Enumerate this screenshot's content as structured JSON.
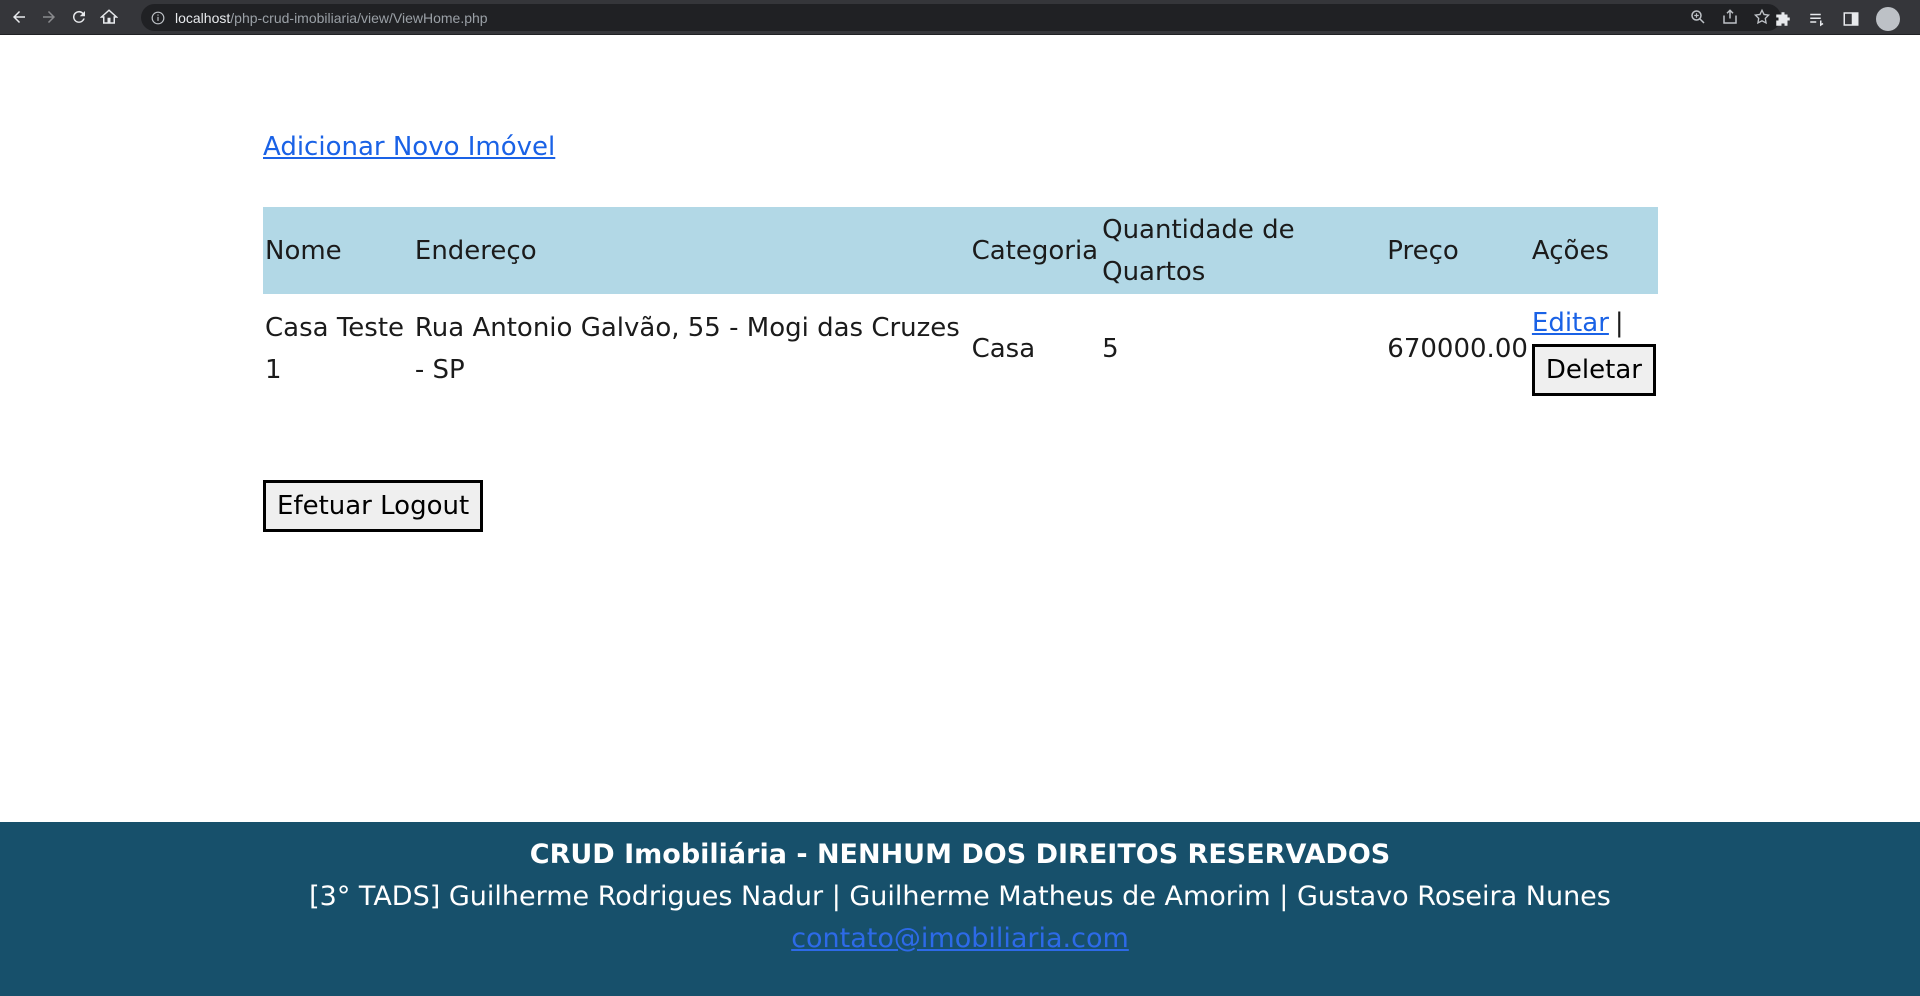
{
  "browser": {
    "url_host": "localhost",
    "url_path": "/php-crud-imobiliaria/view/ViewHome.php"
  },
  "page": {
    "add_link": "Adicionar Novo Imóvel",
    "table": {
      "headers": [
        "Nome",
        "Endereço",
        "Categoria",
        "Quantidade de Quartos",
        "Preço",
        "Ações"
      ],
      "rows": [
        {
          "nome": "Casa Teste 1",
          "endereco": "Rua Antonio Galvão, 55 - Mogi das Cruzes - SP",
          "categoria": "Casa",
          "quartos": "5",
          "preco": "670000.00",
          "edit_label": "Editar",
          "separator": "|",
          "delete_label": "Deletar"
        }
      ]
    },
    "logout_label": "Efetuar Logout"
  },
  "footer": {
    "title": "CRUD Imobiliária - NENHUM DOS DIREITOS RESERVADOS",
    "authors": "[3° TADS] Guilherme Rodrigues Nadur | Guilherme Matheus de Amorim | Gustavo Roseira Nunes",
    "email": "contato@imobiliaria.com"
  },
  "colors": {
    "header_row": "#b2d8e6",
    "footer_bg": "#17506b",
    "link": "#1a62e6"
  }
}
